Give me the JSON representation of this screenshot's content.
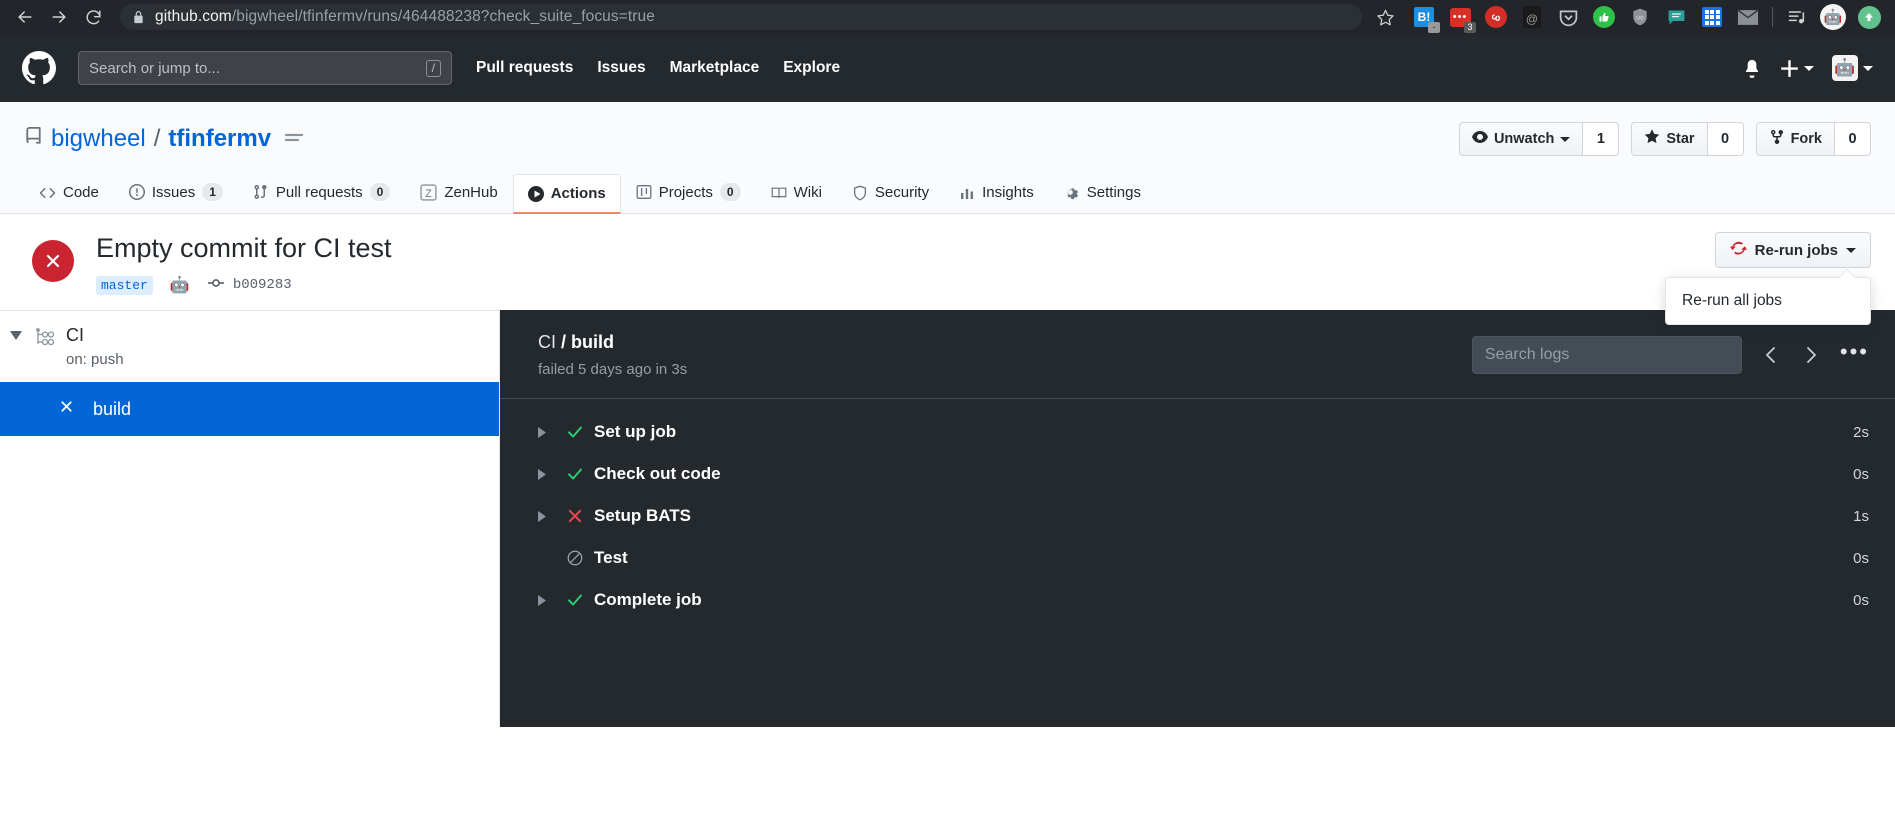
{
  "browser": {
    "back_icon": "arrow-left-icon",
    "forward_icon": "arrow-right-icon",
    "reload_icon": "reload-icon",
    "lock_icon": "lock-icon",
    "url_domain": "github.com",
    "url_path": "/bigwheel/tfinfermv/runs/464488238?check_suite_focus=true",
    "bookmark_icon": "star-outline-icon",
    "extensions": [
      {
        "name": "bang-extension-icon",
        "glyph": "B!",
        "badge": "-"
      },
      {
        "name": "chat-extension-icon",
        "glyph": "•••",
        "badge": "3"
      },
      {
        "name": "lastpass-extension-icon",
        "glyph": "@",
        "badge": ""
      },
      {
        "name": "evernote-extension-icon",
        "glyph": "@",
        "badge": ""
      },
      {
        "name": "pocket-extension-icon",
        "glyph": "v",
        "badge": ""
      },
      {
        "name": "thumbs-up-extension-icon",
        "glyph": "",
        "badge": ""
      },
      {
        "name": "ublock-extension-icon",
        "glyph": "uo",
        "badge": ""
      },
      {
        "name": "notes-extension-icon",
        "glyph": "",
        "badge": ""
      },
      {
        "name": "apps-grid-extension-icon",
        "glyph": "",
        "badge": ""
      },
      {
        "name": "mail-extension-icon",
        "glyph": "",
        "badge": ""
      },
      {
        "name": "playlist-extension-icon",
        "glyph": "",
        "badge": ""
      },
      {
        "name": "profile-avatar-icon",
        "glyph": "",
        "badge": ""
      },
      {
        "name": "upload-extension-icon",
        "glyph": "",
        "badge": ""
      }
    ]
  },
  "gh_header": {
    "logo_icon": "github-mark-icon",
    "search_placeholder": "Search or jump to...",
    "search_value": "",
    "slash_hint": "/",
    "nav": [
      {
        "label": "Pull requests"
      },
      {
        "label": "Issues"
      },
      {
        "label": "Marketplace"
      },
      {
        "label": "Explore"
      }
    ],
    "bell_icon": "bell-icon",
    "plus_icon": "plus-icon",
    "avatar_icon": "user-avatar-icon"
  },
  "repo": {
    "book_icon": "repo-book-icon",
    "owner": "bigwheel",
    "separator": "/",
    "name": "tfinfermv",
    "menu_icon": "kebab-list-icon",
    "watch": {
      "icon": "eye-icon",
      "label": "Unwatch",
      "count": "1"
    },
    "star": {
      "icon": "star-icon",
      "label": "Star",
      "count": "0"
    },
    "fork": {
      "icon": "fork-icon",
      "label": "Fork",
      "count": "0"
    },
    "tabs": [
      {
        "label": "Code",
        "icon": "code-icon",
        "count": null,
        "selected": false
      },
      {
        "label": "Issues",
        "icon": "issue-opened-icon",
        "count": "1",
        "selected": false
      },
      {
        "label": "Pull requests",
        "icon": "git-pull-request-icon",
        "count": "0",
        "selected": false
      },
      {
        "label": "ZenHub",
        "icon": "zenhub-icon",
        "count": null,
        "selected": false
      },
      {
        "label": "Actions",
        "icon": "play-icon",
        "count": null,
        "selected": true
      },
      {
        "label": "Projects",
        "icon": "project-board-icon",
        "count": "0",
        "selected": false
      },
      {
        "label": "Wiki",
        "icon": "book-icon",
        "count": null,
        "selected": false
      },
      {
        "label": "Security",
        "icon": "shield-icon",
        "count": null,
        "selected": false
      },
      {
        "label": "Insights",
        "icon": "graph-icon",
        "count": null,
        "selected": false
      },
      {
        "label": "Settings",
        "icon": "gear-icon",
        "count": null,
        "selected": false
      }
    ]
  },
  "commit": {
    "status_icon": "x-failure-icon",
    "status_color": "#cb2431",
    "title": "Empty commit for CI test",
    "branch": "master",
    "author_avatar_icon": "author-avatar-icon",
    "commit_icon": "git-commit-icon",
    "sha": "b009283"
  },
  "rerun": {
    "icon": "sync-refresh-icon",
    "icon_color": "#cb2431",
    "label": "Re-run jobs",
    "caret_icon": "chevron-down-icon",
    "menu_open": true,
    "menu_items": [
      {
        "label": "Re-run all jobs"
      }
    ]
  },
  "sidebar": {
    "workflow": {
      "collapse_icon": "triangle-down-icon",
      "icon": "workflow-icon",
      "name": "CI",
      "trigger": "on: push"
    },
    "jobs": [
      {
        "name": "build",
        "status_icon": "x-icon",
        "selected": true
      }
    ]
  },
  "logs": {
    "breadcrumb_prefix": "CI",
    "breadcrumb_sep": "/",
    "breadcrumb_job": "build",
    "status_line": "failed 5 days ago in 3s",
    "search_placeholder": "Search logs",
    "search_value": "",
    "prev_icon": "chevron-left-icon",
    "next_icon": "chevron-right-icon",
    "kebab_icon": "kebab-horizontal-icon",
    "steps": [
      {
        "name": "Set up job",
        "status": "success",
        "status_icon": "check-icon",
        "duration": "2s",
        "expandable": true
      },
      {
        "name": "Check out code",
        "status": "success",
        "status_icon": "check-icon",
        "duration": "0s",
        "expandable": true
      },
      {
        "name": "Setup BATS",
        "status": "failure",
        "status_icon": "x-icon",
        "duration": "1s",
        "expandable": true
      },
      {
        "name": "Test",
        "status": "skipped",
        "status_icon": "skipped-icon",
        "duration": "0s",
        "expandable": false
      },
      {
        "name": "Complete job",
        "status": "success",
        "status_icon": "check-icon",
        "duration": "0s",
        "expandable": true
      }
    ]
  },
  "colors": {
    "accent_blue": "#0366d6",
    "success_green": "#28a745",
    "failure_red": "#cb2431",
    "dark_bg": "#24292e",
    "selected_tab_underline": "#f9826c"
  }
}
